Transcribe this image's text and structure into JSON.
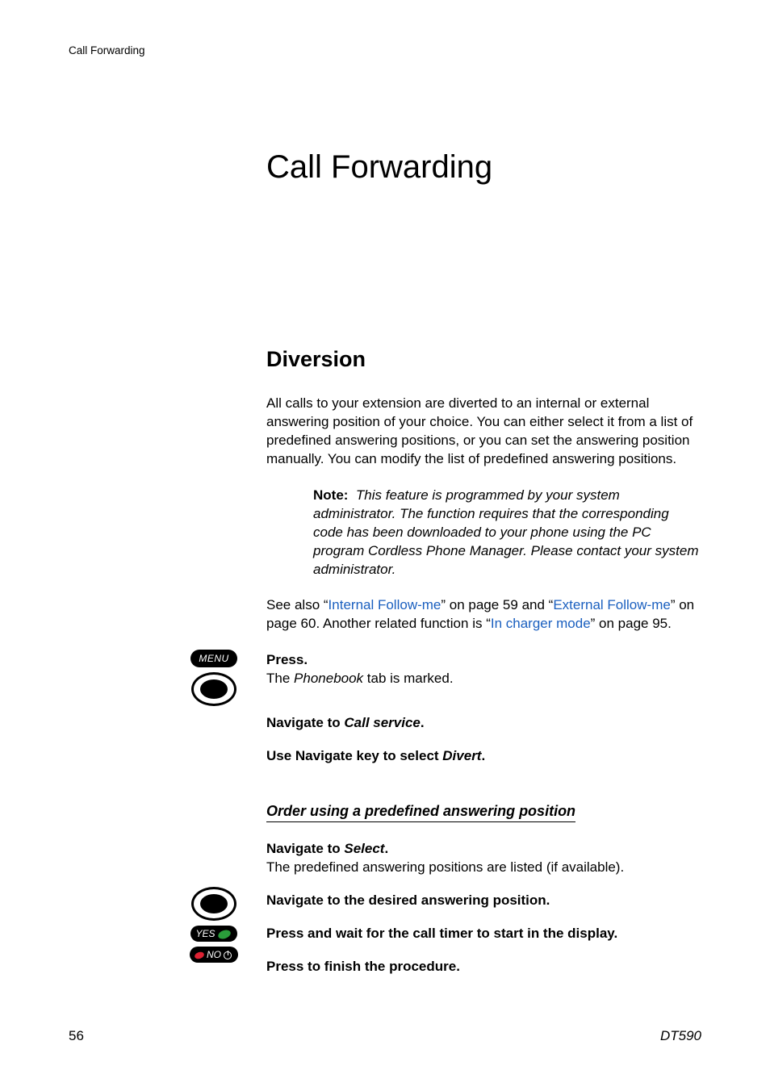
{
  "header": {
    "running_head": "Call Forwarding"
  },
  "title": "Call Forwarding",
  "section": {
    "heading": "Diversion",
    "intro": "All calls to your extension are diverted to an internal or external answering position of your choice. You can either select it from a list of predefined answering positions, or you can set the answering position manually. You can modify the list of predefined answering positions.",
    "note": {
      "label": "Note:",
      "text": "This feature is programmed by your system administrator. The function requires that the corresponding code has been downloaded to your phone using the PC program Cordless Phone Manager. Please contact your system administrator."
    },
    "seealso": {
      "pre": "See also “",
      "link1": "Internal Follow-me",
      "mid1": "” on page 59 and “",
      "link2": "External Follow-me",
      "mid2": "” on page 60. Another related function is “",
      "link3": "In charger mode",
      "post": "” on page 95."
    }
  },
  "icons": {
    "menu_label": "MENU",
    "yes_label": "YES",
    "no_label": "NO"
  },
  "steps": {
    "press": {
      "bold": "Press.",
      "rest_pre": "The ",
      "rest_em": "Phonebook",
      "rest_post": " tab is marked."
    },
    "nav_callservice": {
      "pre": "Navigate to ",
      "em": "Call service",
      "post": "."
    },
    "nav_divert": {
      "pre": "Use Navigate key to select ",
      "em": "Divert",
      "post": "."
    }
  },
  "subhead": "Order using a predefined answering position",
  "steps2": {
    "nav_select": {
      "pre": "Navigate to ",
      "em": "Select",
      "post": ".",
      "sub": "The predefined answering positions are listed (if available)."
    },
    "nav_pos": "Navigate to the desired answering position.",
    "press_wait": "Press and wait for the call timer to start in the display.",
    "press_finish": "Press to finish the procedure."
  },
  "footer": {
    "page": "56",
    "model": "DT590"
  }
}
